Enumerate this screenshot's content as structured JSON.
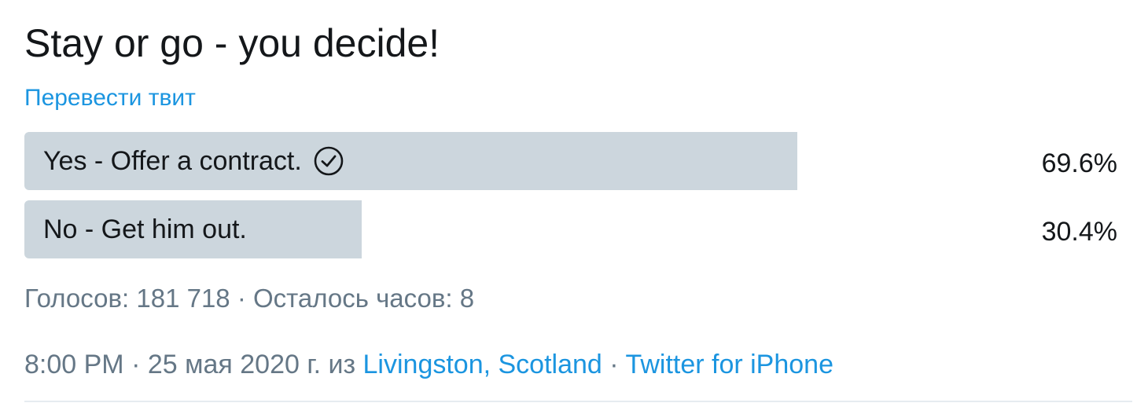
{
  "tweet": {
    "text": "Stay or go - you decide!",
    "translate_label": "Перевести твит"
  },
  "poll": {
    "options": [
      {
        "label": "Yes - Offer a contract.",
        "percent_label": "69.6%",
        "percent": 69.6,
        "winner": true
      },
      {
        "label": "No - Get him out.",
        "percent_label": "30.4%",
        "percent": 30.4,
        "winner": false
      }
    ],
    "votes_text": "Голосов: 181 718",
    "separator": " · ",
    "remaining_text": "Осталось часов: 8"
  },
  "meta": {
    "time": "8:00 PM",
    "separator": " · ",
    "date": "25 мая 2020 г.",
    "from_word": " из ",
    "location": "Livingston, Scotland",
    "source": "Twitter for iPhone"
  },
  "colors": {
    "text": "#14171a",
    "secondary": "#657786",
    "link": "#1b95e0",
    "bar": "#ccd6dd"
  },
  "icons": {
    "winner": "check-circle-icon"
  }
}
